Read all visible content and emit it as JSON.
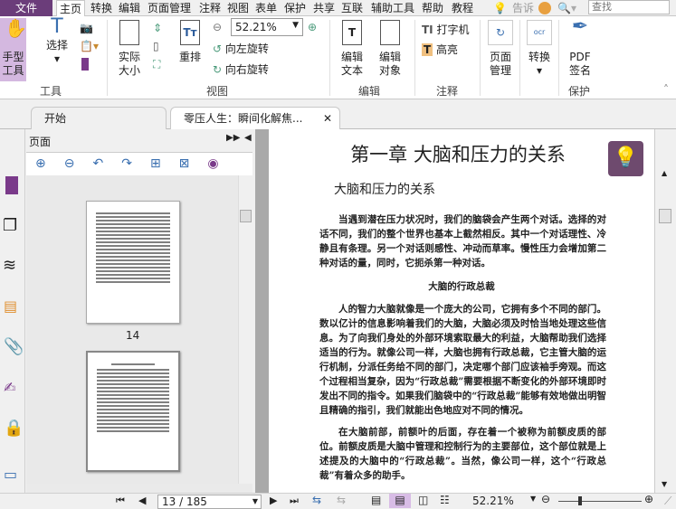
{
  "menu": {
    "file": "文件",
    "items": [
      "主页",
      "转换",
      "编辑",
      "页面管理",
      "注释",
      "视图",
      "表单",
      "保护",
      "共享",
      "互联",
      "辅助工具",
      "帮助",
      "教程"
    ],
    "tell": "告诉",
    "search_placeholder": "查找"
  },
  "ribbon": {
    "hand": "手型\n工具",
    "select": "选择",
    "tools_group": "工具",
    "actual_size": "实际\n大小",
    "reflow": "重排",
    "zoom_value": "52.21%",
    "rotate_left": "向左旋转",
    "rotate_right": "向右旋转",
    "view_group": "视图",
    "edit_text": "编辑\n文本",
    "edit_object": "编辑\n对象",
    "edit_group": "编辑",
    "typewriter": "打字机",
    "highlight": "高亮",
    "comment_group": "注释",
    "page_manage": "页面\n管理",
    "convert": "转换",
    "pdf_sign": "PDF\n签名",
    "protect_group": "保护"
  },
  "tabs": [
    {
      "label": "开始"
    },
    {
      "label": "零压人生：瞬间化解焦..."
    }
  ],
  "panel": {
    "title": "页面",
    "thumb_label": "14"
  },
  "document": {
    "chapter": "第一章 大脑和压力的关系",
    "heading": "大脑和压力的关系",
    "para1": "当遇到潜在压力状况时，我们的脑袋会产生两个对话。选择的对话不同，我们的整个世界也基本上截然相反。其中一个对话理性、冷静且有条理。另一个对话则感性、冲动而草率。慢性压力会增加第二种对话的量，同时，它扼杀第一种对话。",
    "subheading": "大脑的行政总裁",
    "para2": "人的智力大脑就像是一个庞大的公司，它拥有多个不同的部门。数以亿计的信息影响着我们的大脑，大脑必须及时恰当地处理这些信息。为了向我们身处的外部环境索取最大的利益，大脑帮助我们选择适当的行为。就像公司一样，大脑也拥有行政总裁，它主管大脑的运行机制，分派任务给不同的部门，决定哪个部门应该袖手旁观。而这个过程相当复杂，因为“行政总裁”需要根据不断变化的外部环境即时发出不同的指令。如果我们脑袋中的“行政总裁”能够有效地做出明智且精确的指引，我们就能出色地应对不同的情况。",
    "para3": "在大脑前部，前额叶的后面，存在着一个被称为前额皮质的部位。前额皮质是大脑中管理和控制行为的主要部位，这个部位就是上述提及的大脑中的“行政总裁”。当然，像公司一样，这个“行政总裁”有着众多的助手。"
  },
  "status": {
    "page": "13 / 185",
    "zoom": "52.21%",
    "zoom_slider_percent": 52
  },
  "colors": {
    "accent": "#6b3d7a",
    "hand_bg": "#d4b8e0",
    "tip_bg": "#6e4a6e"
  }
}
